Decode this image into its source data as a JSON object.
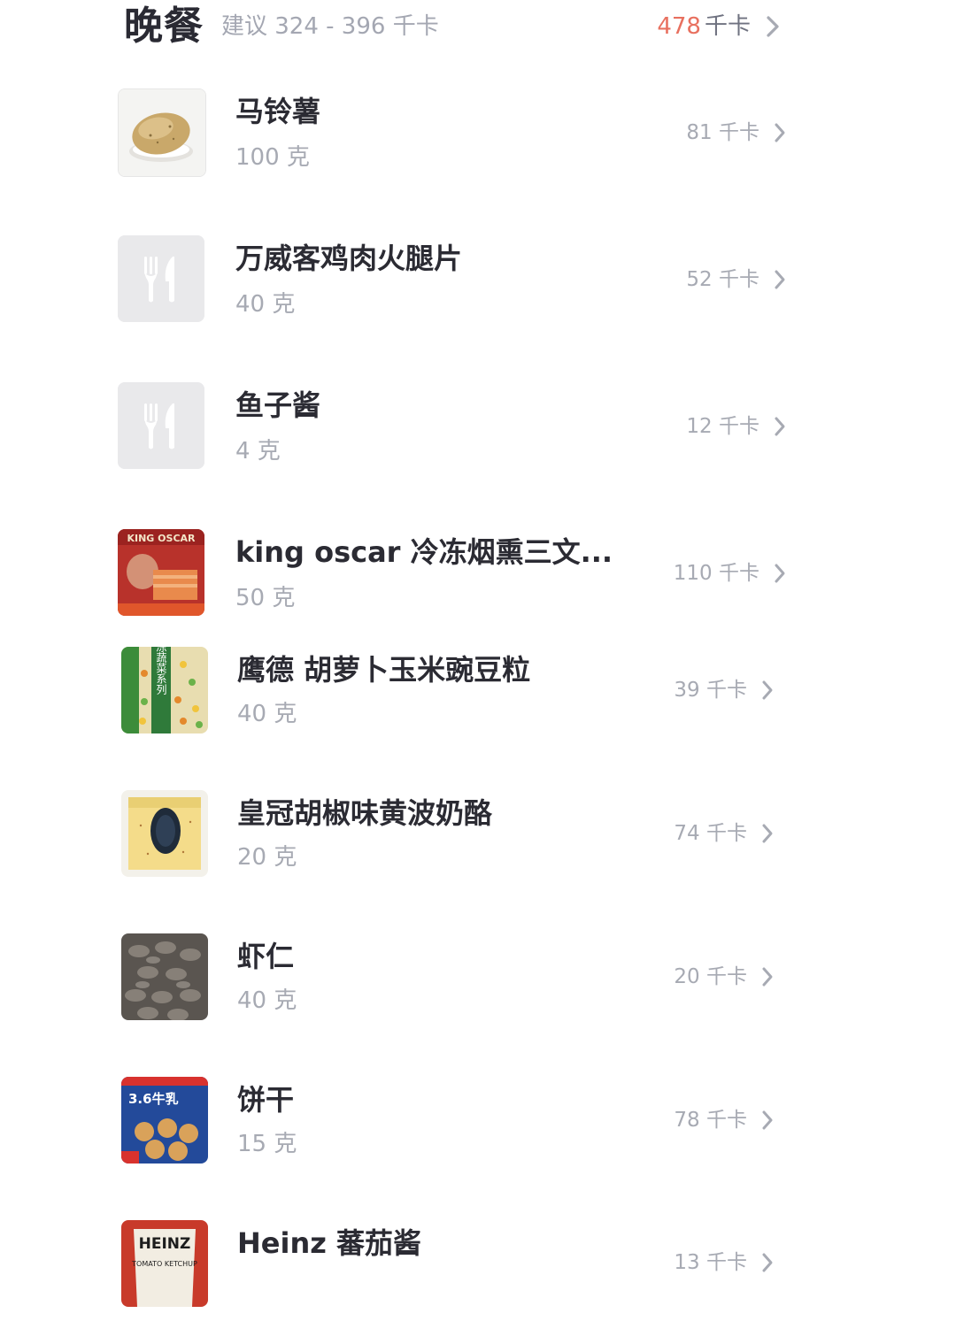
{
  "meal": {
    "title": "晚餐",
    "suggestion": "建议 324 - 396 千卡",
    "total_value": "478",
    "total_unit": "千卡"
  },
  "foods": [
    {
      "name": "马铃薯",
      "amount": "100 克",
      "kcal": "81 千卡",
      "thumb": "potato-photo"
    },
    {
      "name": "万威客鸡肉火腿片",
      "amount": "40 克",
      "kcal": "52 千卡",
      "thumb": "cutlery-icon"
    },
    {
      "name": "鱼子酱",
      "amount": "4 克",
      "kcal": "12 千卡",
      "thumb": "cutlery-icon"
    },
    {
      "name": "king oscar  冷冻烟熏三文...",
      "amount": "50 克",
      "kcal": "110 千卡",
      "thumb": "salmon-package-photo"
    },
    {
      "name": "鹰德 胡萝卜玉米豌豆粒",
      "amount": "40 克",
      "kcal": "39 千卡",
      "thumb": "mixed-vegetables-photo"
    },
    {
      "name": "皇冠胡椒味黄波奶酪",
      "amount": "20 克",
      "kcal": "74 千卡",
      "thumb": "cheese-photo"
    },
    {
      "name": "虾仁",
      "amount": "40 克",
      "kcal": "20 千卡",
      "thumb": "shrimp-photo"
    },
    {
      "name": "饼干",
      "amount": "15 克",
      "kcal": "78 千卡",
      "thumb": "biscuit-package-photo"
    },
    {
      "name": "Heinz 蕃茄酱",
      "amount": "",
      "kcal": "13 千卡",
      "thumb": "ketchup-bottle-photo"
    }
  ],
  "thumb_texts": {
    "salmon": "KING OSCAR",
    "vegetables": "速冻蔬菜系列",
    "biscuit": "3.6牛乳",
    "ketchup_brand": "HEINZ",
    "ketchup_label": "TOMATO KETCHUP"
  },
  "colors": {
    "accent_red": "#e8705f",
    "text_dark": "#2b2b33",
    "text_muted": "#a7aab3",
    "placeholder_bg": "#e9e9eb"
  }
}
